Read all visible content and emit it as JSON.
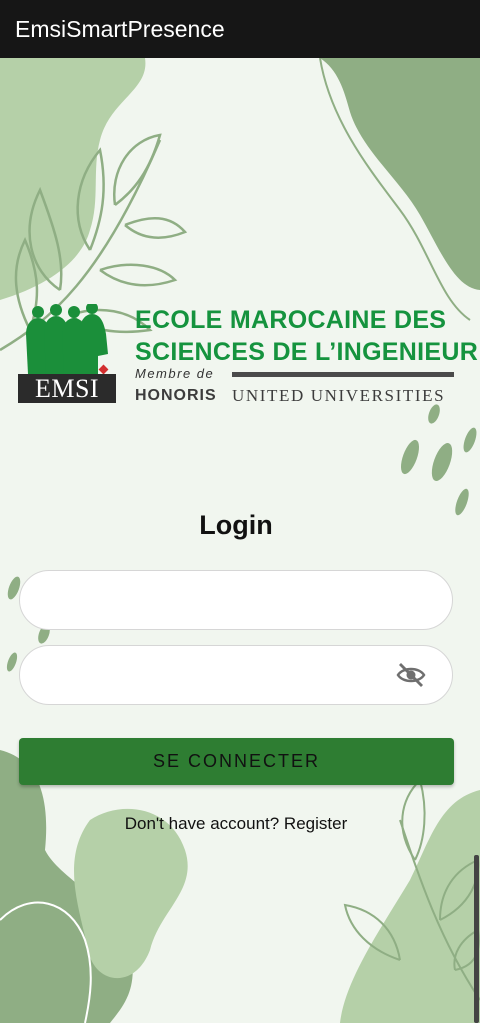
{
  "app": {
    "title": "EmsiSmartPresence"
  },
  "logo": {
    "emsi_text": "EMSI",
    "school_line1": "ECOLE MAROCAINE DES",
    "school_line2": "SCIENCES DE L’INGENIEUR",
    "membre_de": "Membre de",
    "honoris": "HONORIS",
    "united_universities": "UNITED UNIVERSITIES"
  },
  "login": {
    "title": "Login",
    "username": {
      "value": "",
      "placeholder": ""
    },
    "password": {
      "value": "",
      "placeholder": "",
      "toggle_icon": "eye-off-icon"
    },
    "submit_label": "SE CONNECTER",
    "register_text": "Don't have account? Register"
  },
  "colors": {
    "app_bar": "#161616",
    "background": "#f1f6ef",
    "brand_green": "#15933e",
    "button": "#2e7d32",
    "leaf_dark": "#8fae84",
    "leaf_light": "#b5d0a8"
  }
}
